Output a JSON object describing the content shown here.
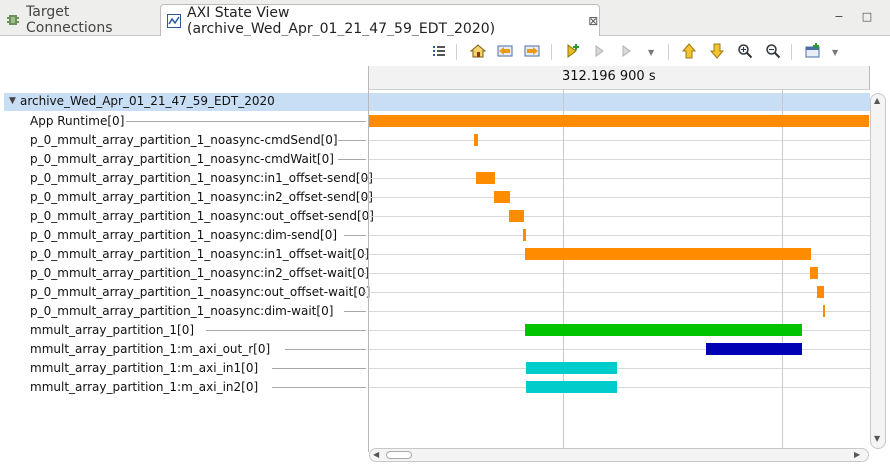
{
  "tabs": [
    {
      "label": "Target Connections",
      "active": false,
      "icon": "target-connections-icon"
    },
    {
      "label": "AXI State View (archive_Wed_Apr_01_21_47_59_EDT_2020)",
      "active": true,
      "icon": "waveform-icon",
      "close": "⊠"
    }
  ],
  "window_controls": {
    "minimize": "−",
    "maximize": "□"
  },
  "toolbar": {
    "buttons": [
      "list-icon",
      "home-icon",
      "back-marker-icon",
      "forward-marker-icon",
      "add-marker-icon",
      "prev-marker-icon",
      "next-marker-icon",
      "up-arrow-icon",
      "down-arrow-icon",
      "zoom-in-icon",
      "zoom-out-icon",
      "view-menu-icon"
    ]
  },
  "cursor_time": "312.196 900 s",
  "group": {
    "label": "archive_Wed_Apr_01_21_47_59_EDT_2020",
    "expanded": true
  },
  "colors": {
    "orange": "#ff8c00",
    "green": "#00c400",
    "navy": "#0000b4",
    "cyan": "#00cccc",
    "selection": "#c7def5"
  },
  "signals": [
    {
      "label": "App Runtime[0]",
      "color": "orange",
      "spans": [
        [
          0.0,
          1.0
        ]
      ]
    },
    {
      "label": "p_0_mmult_array_partition_1_noasync-cmdSend[0]",
      "color": "orange",
      "spans": [
        [
          0.21,
          0.217
        ]
      ]
    },
    {
      "label": "p_0_mmult_array_partition_1_noasync-cmdWait[0]",
      "color": "orange",
      "spans": []
    },
    {
      "label": "p_0_mmult_array_partition_1_noasync:in1_offset-send[0]",
      "color": "orange",
      "spans": [
        [
          0.214,
          0.252
        ]
      ]
    },
    {
      "label": "p_0_mmult_array_partition_1_noasync:in2_offset-send[0]",
      "color": "orange",
      "spans": [
        [
          0.25,
          0.282
        ]
      ]
    },
    {
      "label": "p_0_mmult_array_partition_1_noasync:out_offset-send[0]",
      "color": "orange",
      "spans": [
        [
          0.28,
          0.31
        ]
      ]
    },
    {
      "label": "p_0_mmult_array_partition_1_noasync:dim-send[0]",
      "color": "orange",
      "spans": [
        [
          0.308,
          0.314
        ]
      ]
    },
    {
      "label": "p_0_mmult_array_partition_1_noasync:in1_offset-wait[0]",
      "color": "orange",
      "spans": [
        [
          0.312,
          0.884
        ]
      ]
    },
    {
      "label": "p_0_mmult_array_partition_1_noasync:in2_offset-wait[0]",
      "color": "orange",
      "spans": [
        [
          0.882,
          0.898
        ]
      ]
    },
    {
      "label": "p_0_mmult_array_partition_1_noasync:out_offset-wait[0]",
      "color": "orange",
      "spans": [
        [
          0.896,
          0.91
        ]
      ]
    },
    {
      "label": "p_0_mmult_array_partition_1_noasync:dim-wait[0]",
      "color": "orange",
      "spans": [
        [
          0.908,
          0.912
        ]
      ]
    },
    {
      "label": "mmult_array_partition_1[0]",
      "color": "green",
      "spans": [
        [
          0.312,
          0.866
        ]
      ]
    },
    {
      "label": "mmult_array_partition_1:m_axi_out_r[0]",
      "color": "navy",
      "spans": [
        [
          0.674,
          0.866
        ]
      ]
    },
    {
      "label": "mmult_array_partition_1:m_axi_in1[0]",
      "color": "cyan",
      "spans": [
        [
          0.314,
          0.496
        ]
      ]
    },
    {
      "label": "mmult_array_partition_1:m_axi_in2[0]",
      "color": "cyan",
      "spans": [
        [
          0.314,
          0.496
        ]
      ]
    }
  ]
}
